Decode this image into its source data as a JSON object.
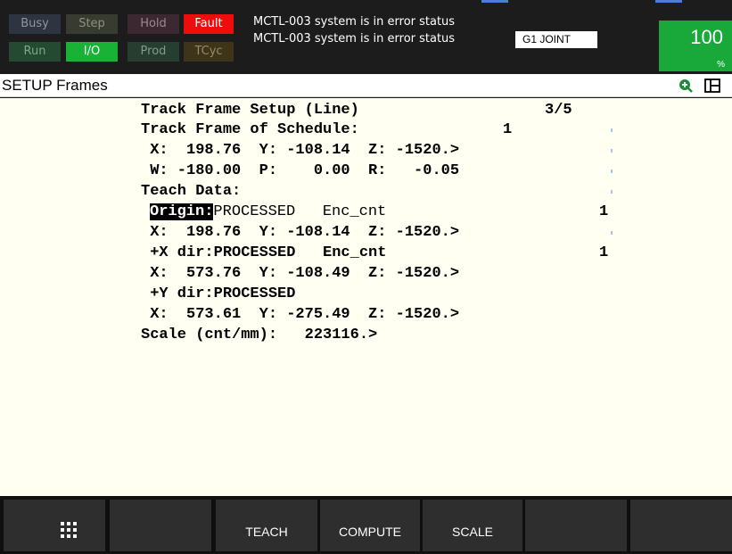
{
  "status": {
    "busy": "Busy",
    "step": "Step",
    "hold": "Hold",
    "fault": "Fault",
    "run": "Run",
    "io": "I/O",
    "prod": "Prod",
    "tcyc": "TCyc"
  },
  "messages": {
    "line1": "MCTL-003 system is in error status",
    "line2": "MCTL-003 system is in error status",
    "joint": "G1 JOINT"
  },
  "override": {
    "value": "100",
    "unit": "%"
  },
  "title": "SETUP Frames",
  "screen": {
    "header": "Track Frame Setup (Line)",
    "page": "3/5",
    "schedule_label": "Track Frame of Schedule:",
    "schedule_value": "1",
    "frame_xyz": " X:  198.76  Y: -108.14  Z: -1520.>",
    "frame_wpr": " W: -180.00  P:    0.00  R:   -0.05",
    "teach_data": "Teach Data:",
    "origin_label": "Origin:",
    "origin_status": "PROCESSED   Enc_cnt",
    "origin_enc": "1",
    "origin_xyz": " X:  198.76  Y: -108.14  Z: -1520.>",
    "xdir_line": " +X dir:PROCESSED   Enc_cnt",
    "xdir_enc": "1",
    "xdir_xyz": " X:  573.76  Y: -108.49  Z: -1520.>",
    "ydir_line": " +Y dir:PROCESSED",
    "ydir_xyz": " X:  573.61  Y: -275.49  Z: -1520.>",
    "scale_line": "Scale (cnt/mm):   223116.>"
  },
  "softkeys": [
    "",
    "",
    "TEACH",
    "COMPUTE",
    "SCALE",
    "",
    ""
  ],
  "icons": {
    "menu": "grid-menu-icon",
    "zoom": "zoom-in-icon",
    "layout": "split-screen-icon"
  },
  "colors": {
    "fault": "#ee0c0c",
    "io_active": "#17b236",
    "override": "#19a83a",
    "content_bg": "#fffff2"
  }
}
